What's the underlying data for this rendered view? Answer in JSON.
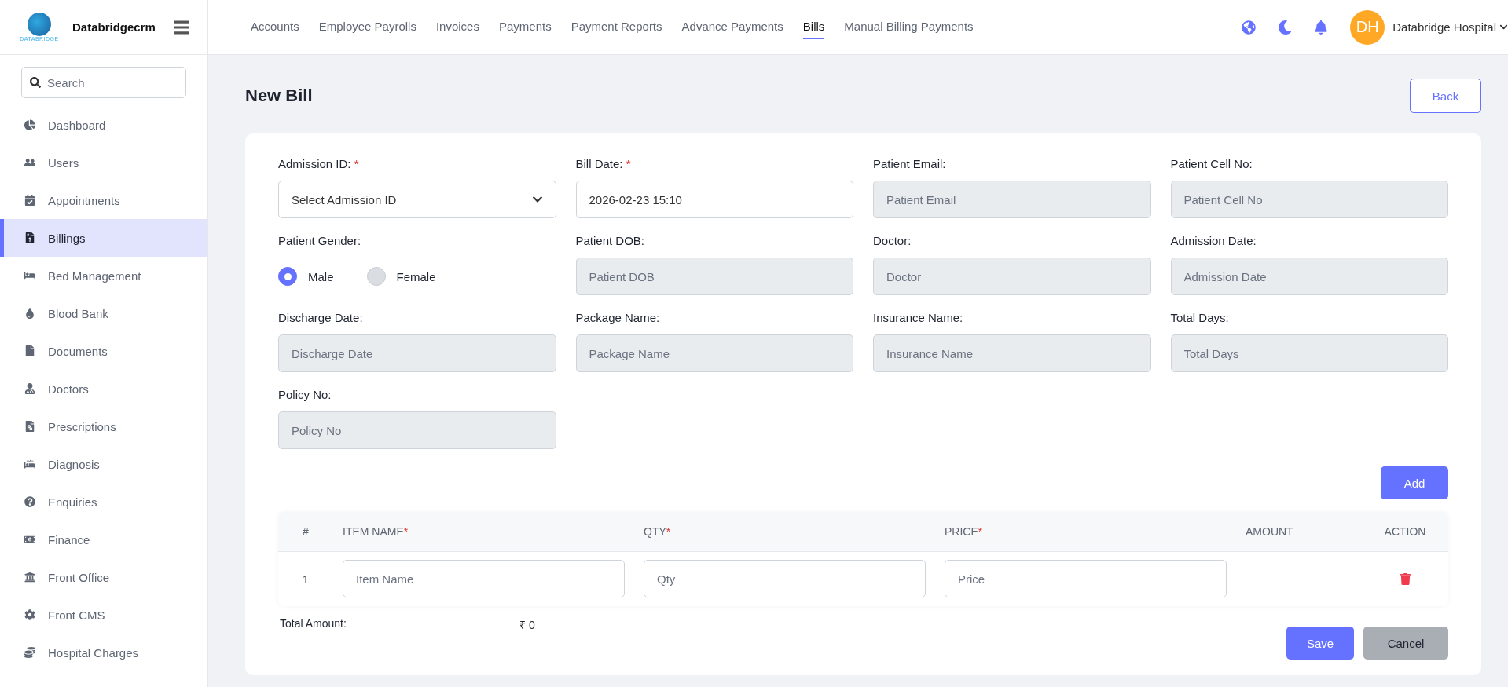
{
  "brand": {
    "name": "Databridgecrm",
    "logo_text": "DATABRIDGE"
  },
  "search": {
    "placeholder": "Search"
  },
  "sidebar": {
    "items": [
      {
        "label": "Dashboard",
        "selected": false
      },
      {
        "label": "Users",
        "selected": false
      },
      {
        "label": "Appointments",
        "selected": false
      },
      {
        "label": "Billings",
        "selected": true
      },
      {
        "label": "Bed Management",
        "selected": false
      },
      {
        "label": "Blood Bank",
        "selected": false
      },
      {
        "label": "Documents",
        "selected": false
      },
      {
        "label": "Doctors",
        "selected": false
      },
      {
        "label": "Prescriptions",
        "selected": false
      },
      {
        "label": "Diagnosis",
        "selected": false
      },
      {
        "label": "Enquiries",
        "selected": false
      },
      {
        "label": "Finance",
        "selected": false
      },
      {
        "label": "Front Office",
        "selected": false
      },
      {
        "label": "Front CMS",
        "selected": false
      },
      {
        "label": "Hospital Charges",
        "selected": false
      }
    ]
  },
  "top_tabs": [
    {
      "label": "Accounts",
      "selected": false
    },
    {
      "label": "Employee Payrolls",
      "selected": false
    },
    {
      "label": "Invoices",
      "selected": false
    },
    {
      "label": "Payments",
      "selected": false
    },
    {
      "label": "Payment Reports",
      "selected": false
    },
    {
      "label": "Advance Payments",
      "selected": false
    },
    {
      "label": "Bills",
      "selected": true
    },
    {
      "label": "Manual Billing Payments",
      "selected": false
    }
  ],
  "user": {
    "initials": "DH",
    "name": "Databridge Hospital"
  },
  "page": {
    "title": "New Bill",
    "back": "Back"
  },
  "fields": [
    {
      "kind": "select",
      "label": "Admission ID:",
      "required_mark": "*",
      "placeholder": "Select Admission ID"
    },
    {
      "kind": "input",
      "label": "Bill Date:",
      "required_mark": "*",
      "value": "2026-02-23 15:10",
      "disabled": false
    },
    {
      "kind": "input",
      "label": "Patient Email:",
      "placeholder": "Patient Email",
      "disabled": true
    },
    {
      "kind": "input",
      "label": "Patient Cell No:",
      "placeholder": "Patient Cell No",
      "disabled": true
    },
    {
      "kind": "radio",
      "label": "Patient Gender:",
      "options": [
        {
          "label": "Male",
          "selected": true
        },
        {
          "label": "Female",
          "selected": false
        }
      ]
    },
    {
      "kind": "input",
      "label": "Patient DOB:",
      "placeholder": "Patient DOB",
      "disabled": true
    },
    {
      "kind": "input",
      "label": "Doctor:",
      "placeholder": "Doctor",
      "disabled": true
    },
    {
      "kind": "input",
      "label": "Admission Date:",
      "placeholder": "Admission Date",
      "disabled": true
    },
    {
      "kind": "input",
      "label": "Discharge Date:",
      "placeholder": "Discharge Date",
      "disabled": true
    },
    {
      "kind": "input",
      "label": "Package Name:",
      "placeholder": "Package Name",
      "disabled": true
    },
    {
      "kind": "input",
      "label": "Insurance Name:",
      "placeholder": "Insurance Name",
      "disabled": true
    },
    {
      "kind": "input",
      "label": "Total Days:",
      "placeholder": "Total Days",
      "disabled": true
    },
    {
      "kind": "input",
      "label": "Policy No:",
      "placeholder": "Policy No",
      "disabled": true
    }
  ],
  "add_button": "Add",
  "table": {
    "columns": [
      {
        "label": "#"
      },
      {
        "label": "ITEM NAME",
        "required_mark": "*"
      },
      {
        "label": "QTY",
        "required_mark": "*"
      },
      {
        "label": "PRICE",
        "required_mark": "*"
      },
      {
        "label": "AMOUNT"
      },
      {
        "label": "ACTION"
      }
    ],
    "rows": [
      {
        "index": "1",
        "item_placeholder": "Item Name",
        "qty_placeholder": "Qty",
        "price_placeholder": "Price"
      }
    ]
  },
  "total": {
    "label": "Total Amount:",
    "value": "₹ 0"
  },
  "buttons": {
    "save": "Save",
    "cancel": "Cancel"
  }
}
